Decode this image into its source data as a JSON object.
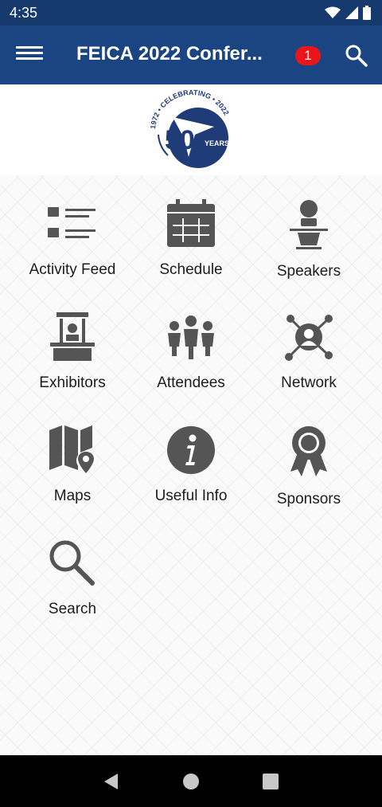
{
  "status": {
    "time": "4:35"
  },
  "app_bar": {
    "title": "FEICA 2022 Confer...",
    "notification_count": "1"
  },
  "logo": {
    "year_start": "1972",
    "year_end": "2022",
    "celebrating": "CELEBRATING",
    "number": "50",
    "years": "YEARS"
  },
  "tiles": [
    {
      "label": "Activity Feed",
      "icon": "activity-feed-icon"
    },
    {
      "label": "Schedule",
      "icon": "calendar-icon"
    },
    {
      "label": "Speakers",
      "icon": "speaker-podium-icon"
    },
    {
      "label": "Exhibitors",
      "icon": "exhibitor-booth-icon"
    },
    {
      "label": "Attendees",
      "icon": "people-group-icon"
    },
    {
      "label": "Network",
      "icon": "network-icon"
    },
    {
      "label": "Maps",
      "icon": "map-pin-icon"
    },
    {
      "label": "Useful Info",
      "icon": "info-icon"
    },
    {
      "label": "Sponsors",
      "icon": "award-ribbon-icon"
    },
    {
      "label": "Search",
      "icon": "search-icon"
    }
  ],
  "colors": {
    "status_bar": "#173a6e",
    "app_bar": "#1a4582",
    "badge": "#e8151b",
    "icon_gray": "#555555",
    "logo_navy": "#1f3b78"
  }
}
